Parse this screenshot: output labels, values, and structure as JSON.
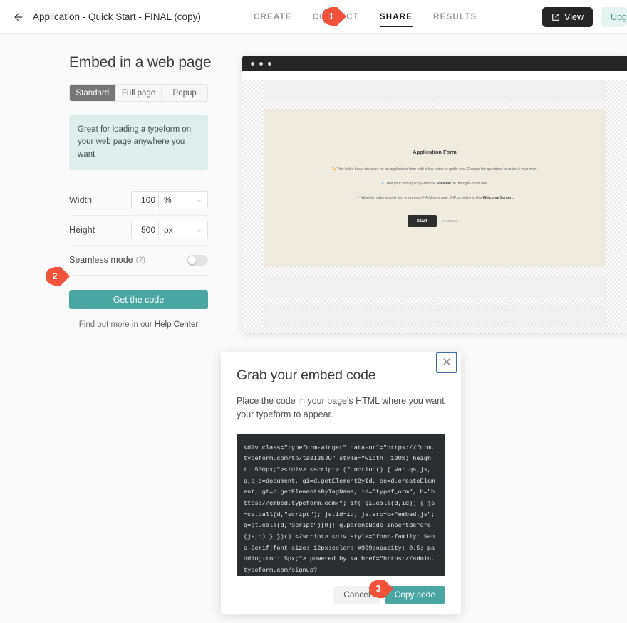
{
  "topbar": {
    "back_icon": "arrow-left-icon",
    "form_title": "Application - Quick Start - FINAL (copy)",
    "tabs": [
      {
        "label": "CREATE",
        "active": false
      },
      {
        "label": "CONNECT",
        "active": false
      },
      {
        "label": "SHARE",
        "active": true
      },
      {
        "label": "RESULTS",
        "active": false
      }
    ],
    "view_button": "View",
    "view_icon": "external-link-icon",
    "upgrade_button": "Upgrade"
  },
  "left_panel": {
    "title": "Embed in a web page",
    "segments": [
      {
        "label": "Standard",
        "active": true
      },
      {
        "label": "Full page",
        "active": false
      },
      {
        "label": "Popup",
        "active": false
      }
    ],
    "info_text": "Great for loading a typeform on your web page anywhere you want",
    "width": {
      "label": "Width",
      "value": "100",
      "unit": "%"
    },
    "height": {
      "label": "Height",
      "value": "500",
      "unit": "px"
    },
    "seamless": {
      "label": "Seamless mode",
      "help": "(?)",
      "enabled": false
    },
    "cta_label": "Get the code",
    "help_prefix": "Find out more in our ",
    "help_link": "Help Center"
  },
  "preview": {
    "title": "Application Form",
    "line1_emoji": "✏️",
    "line1": "This is the basic structure for an application form with a few notes to guide you. Change the questions to make it your own.",
    "line2_emoji": "🔹",
    "line2_pre": "Test your form quickly with the ",
    "line2_bold": "Preview",
    "line2_post": " on the right-hand side.",
    "line3_emoji": "🔹",
    "line3_pre": "Want to make a good first impression? Add an image, GIF, or video to this ",
    "line3_bold": "Welcome Screen.",
    "start_label": "Start",
    "start_hint": "press Enter ↵"
  },
  "modal": {
    "title": "Grab your embed code",
    "description": "Place the code in your page's HTML where you want your typeform to appear.",
    "close_icon": "close-icon",
    "code": "<div class=\"typeform-widget\" data-url=\"https://form.typeform.com/to/ta9I26JU\" style=\"width: 100%; height: 500px;\"></div> <script> (function() { var qs,js,q,s,d=document, gi=d.getElementById, ce=d.createElement, gt=d.getElementsByTagName, id=\"typef_orm\", b=\"https://embed.typeform.com/\"; if(!gi.call(d,id)) { js=ce.call(d,\"script\"); js.id=id; js.src=b+\"embed.js\"; q=gt.call(d,\"script\")[0]; q.parentNode.insertBefore(js,q) } })() </script> <div style=\"font-family: Sans-Serif;font-size: 12px;color: #999;opacity: 0.5; padding-top: 5px;\"> powered by <a href=\"https://admin.typeform.com/signup?",
    "cancel_label": "Cancel",
    "copy_label": "Copy code"
  },
  "markers": [
    {
      "number": "1"
    },
    {
      "number": "2"
    },
    {
      "number": "3"
    }
  ],
  "colors": {
    "accent_teal": "#4aa6a1",
    "marker_red": "#f0523c",
    "info_bg": "#ddeeeb",
    "code_bg": "#2b2d30",
    "preview_bg": "#efebdf"
  }
}
